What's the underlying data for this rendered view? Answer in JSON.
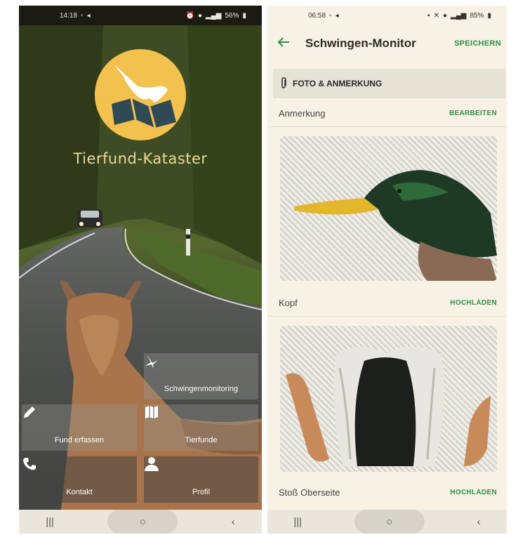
{
  "left_phone": {
    "status": {
      "time": "14:18",
      "battery": "56%"
    },
    "app_title": "Tierfund-Kataster",
    "tiles": {
      "schwingen": "Schwingenmonitoring",
      "fund": "Fund erfassen",
      "tierfunde": "Tierfunde",
      "kontakt": "Kontakt",
      "profil": "Profil"
    }
  },
  "right_phone": {
    "status": {
      "time": "06:58",
      "battery": "85%"
    },
    "title": "Schwingen-Monitor",
    "save_label": "SPEICHERN",
    "section_title": "FOTO & ANMERKUNG",
    "rows": {
      "anmerkung": {
        "label": "Anmerkung",
        "action": "BEARBEITEN"
      },
      "kopf": {
        "label": "Kopf",
        "action": "HOCHLADEN"
      },
      "stoss": {
        "label": "Stoß Oberseite",
        "action": "HOCHLADEN"
      }
    }
  },
  "colors": {
    "accent": "#2f8f4a",
    "logo": "#f2c14e",
    "title_gold": "#efd99a"
  },
  "icons": [
    "signal-icon",
    "wifi-icon",
    "battery-icon",
    "alarm-icon",
    "location-icon",
    "bird-icon",
    "pencil-icon",
    "map-icon",
    "phone-icon",
    "person-icon",
    "back-arrow-icon",
    "paperclip-icon"
  ]
}
